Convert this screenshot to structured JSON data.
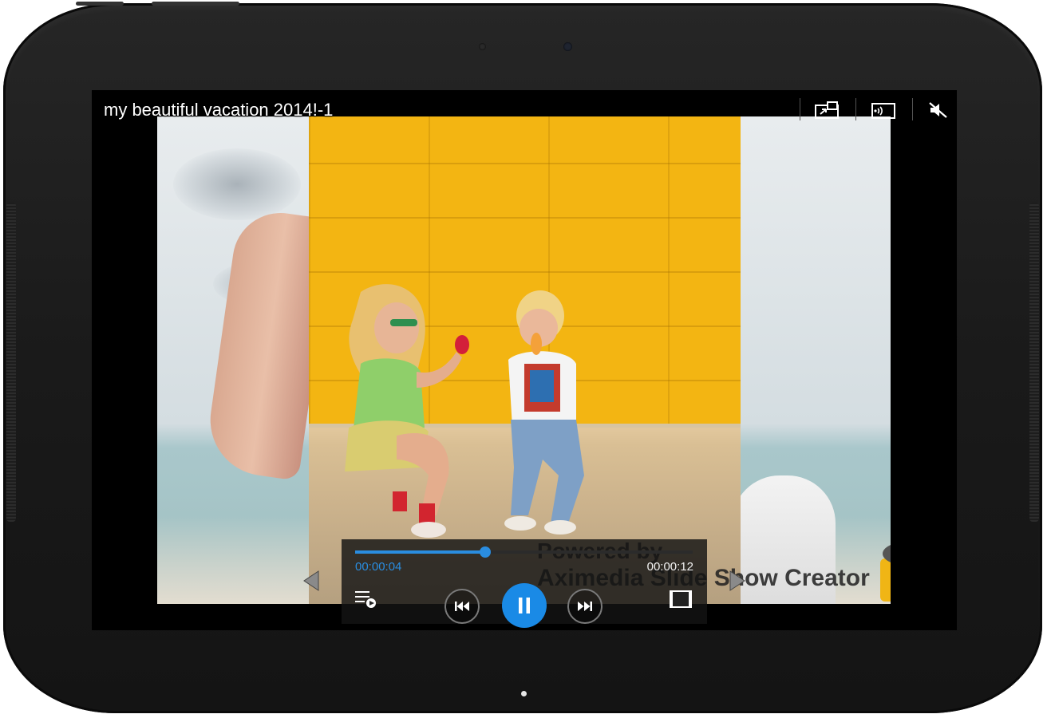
{
  "video": {
    "title": "my beautiful vacation 2014!-1"
  },
  "toolbar": {
    "icons": [
      "popup-player-icon",
      "screen-mirroring-icon",
      "mute-icon"
    ]
  },
  "watermark": {
    "line1": "Powered by",
    "line2": "Aximedia Slide Show Creator"
  },
  "player": {
    "current_time": "00:00:04",
    "total_time": "00:00:12",
    "progress": 0.385,
    "accent_color": "#1a8ae6"
  }
}
